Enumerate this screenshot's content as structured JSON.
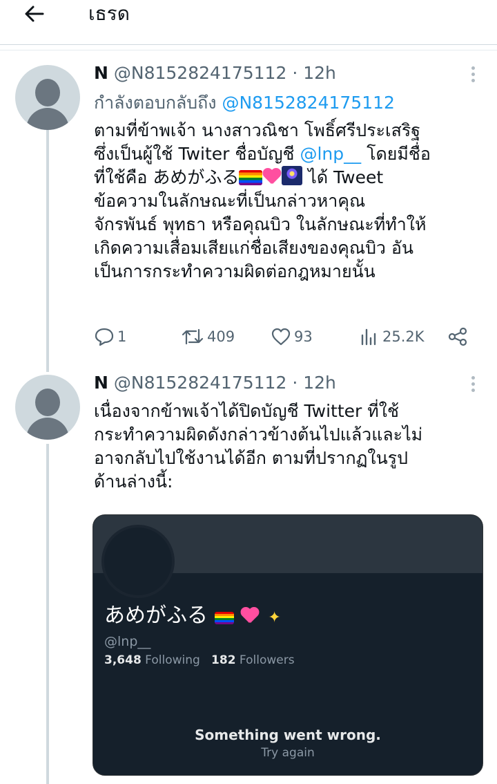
{
  "header": {
    "title": "เธรด"
  },
  "tweets": [
    {
      "name": "N",
      "handle": "@N8152824175112",
      "separator": " · ",
      "time": "12h",
      "reply_label": "กำลังตอบกลับถึง ",
      "reply_handle": "@N8152824175112",
      "lines": {
        "l1": "ตามที่ข้าพเจ้า นางสาวณิชา โพธิ์ศรีประเสริฐ",
        "l2a": "ซึ่งเป็นผู้ใช้ Twiter ชื่อบัญชี ",
        "l2_link": "@lnp__",
        "l2b": " โดยมีชื่อ",
        "l3a": "ที่ใช้คือ あめがふる",
        "l3b": " ได้ Tweet",
        "l4": "ข้อความในลักษณะที่เป็นกล่าวหาคุณ",
        "l5": "จักรพันธ์ พุทธา หรือคุณบิว ในลักษณะที่ทำให้",
        "l6": "เกิดความเสื่อมเสียแก่ชื่อเสียงของคุณบิว อัน",
        "l7": "เป็นการกระทำความผิดต่อกฎหมายนั้น"
      },
      "stats": {
        "replies": "1",
        "retweets": "409",
        "likes": "93",
        "views": "25.2K"
      },
      "emoji": [
        "rainbow-flag",
        "sparkling-heart",
        "fireworks"
      ]
    },
    {
      "name": "N",
      "handle": "@N8152824175112",
      "separator": " · ",
      "time": "12h",
      "lines": {
        "l1": "เนื่องจากข้าพเจ้าได้ปิดบัญชี Twitter ที่ใช้",
        "l2": "กระทำความผิดดังกล่าวข้างต้นไปแล้วและไม่",
        "l3": "อาจกลับไปใช้งานได้อีก ตามที่ปรากฏในรูป",
        "l4": "ด้านล่างนี้:"
      }
    }
  ],
  "embedded_profile": {
    "display_name": "あめがふる",
    "name_emoji": [
      "rainbow-flag",
      "sparkling-heart",
      "sparkles"
    ],
    "handle": "@lnp__",
    "following_count": "3,648",
    "following_label": " Following",
    "followers_count": "182",
    "followers_label": " Followers",
    "error_text": "Something went wrong.",
    "retry_text": "Try again",
    "colors": {
      "background": "#15202b",
      "banner": "#2c3640"
    }
  },
  "colors": {
    "link": "#1d9bf0",
    "muted": "#536471",
    "text": "#0f1419"
  }
}
